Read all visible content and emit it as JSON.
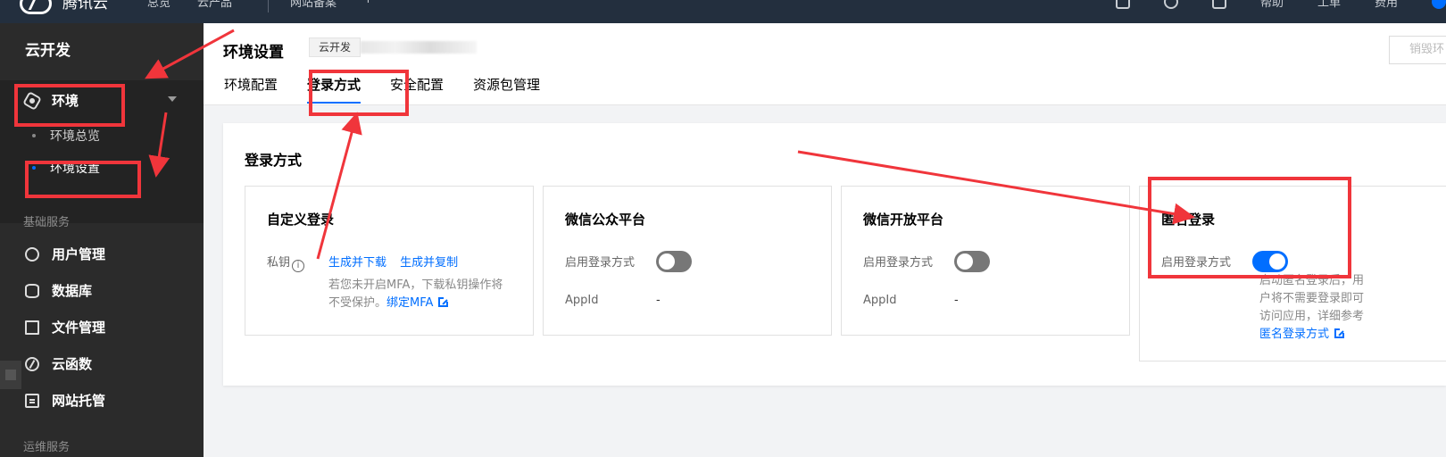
{
  "topbar": {
    "brand": "腾讯云",
    "nav": [
      "总览",
      "云产品"
    ],
    "nav2": [
      "网站备案",
      "+"
    ],
    "right": [
      "帮助",
      "工单",
      "费用"
    ]
  },
  "sidebar": {
    "title": "云开发",
    "env": "环境",
    "env_overview": "环境总览",
    "env_settings": "环境设置",
    "section_basic": "基础服务",
    "items": [
      "用户管理",
      "数据库",
      "文件管理",
      "云函数",
      "网站托管"
    ],
    "section_ops": "运维服务"
  },
  "header": {
    "title": "环境设置",
    "env_tag": "云开发",
    "destroy_button": "销毁环",
    "tabs": [
      "环境配置",
      "登录方式",
      "安全配置",
      "资源包管理"
    ],
    "active_tab": "登录方式"
  },
  "card": {
    "title": "登录方式",
    "methods": {
      "custom": {
        "title": "自定义登录",
        "key_label": "私钥",
        "generate_download": "生成并下载",
        "generate_copy": "生成并复制",
        "note": "若您未开启MFA，下载私钥操作将不受保护。",
        "note_link": "绑定MFA"
      },
      "wechat_mp": {
        "title": "微信公众平台",
        "enable_label": "启用登录方式",
        "appid_label": "AppId",
        "appid_value": "-",
        "enabled": false
      },
      "wechat_open": {
        "title": "微信开放平台",
        "enable_label": "启用登录方式",
        "appid_label": "AppId",
        "appid_value": "-",
        "enabled": false
      },
      "anonymous": {
        "title": "匿名登录",
        "enable_label": "启用登录方式",
        "enabled": true,
        "note": "启动匿名登录后，用户将不需要登录即可访问应用，详细参考",
        "note_link": "匿名登录方式"
      }
    }
  },
  "colors": {
    "accent": "#006eff",
    "annotation": "#f0353b",
    "sidebar_bg": "#2b2b2b",
    "topbar_bg": "#232f3e"
  }
}
